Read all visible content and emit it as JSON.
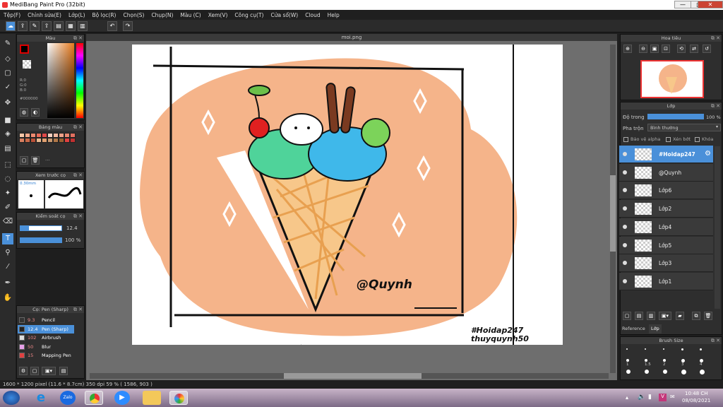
{
  "window": {
    "title": "MediBang Paint Pro (32bit)",
    "min": "—",
    "max": "□",
    "close": "✕"
  },
  "menu": [
    "Tệp(F)",
    "Chỉnh sửa(E)",
    "Lớp(L)",
    "Bộ lọc(R)",
    "Chọn(S)",
    "Chụp(N)",
    "Màu (C)",
    "Xem(V)",
    "Công cụ(T)",
    "Cửa sổ(W)",
    "Cloud",
    "Help"
  ],
  "document": {
    "tab": "moi.png"
  },
  "panels": {
    "color": {
      "title": "Màu",
      "r": "R:0",
      "g": "G:0",
      "b": "B:0",
      "hex": "#000000"
    },
    "palette": {
      "title": "Bảng màu",
      "colors": [
        "#f7c7a8",
        "#f4a98a",
        "#ef8a70",
        "#e86b58",
        "#e04848",
        "#f7d0c0",
        "#f3b8a0",
        "#eea088",
        "#e88870",
        "#e27060",
        "#d88060",
        "#c86848",
        "#b85038",
        "#e8b890",
        "#e0a070",
        "#c89870",
        "#b07848",
        "#986030",
        "#e04040",
        "#c03030"
      ],
      "more": "···"
    },
    "preview": {
      "title": "Xem trước cọ",
      "size": "0.30mm"
    },
    "control": {
      "title": "Kiểm soát cọ",
      "size_value": "12.4",
      "opacity_value": "100 %"
    },
    "brush": {
      "title": "Cọ: Pen (Sharp)",
      "items": [
        {
          "size": "9.3",
          "name": "Pencil",
          "color": "#333"
        },
        {
          "size": "12.4",
          "name": "Pen (Sharp)",
          "color": "#222"
        },
        {
          "size": "102",
          "name": "Airbrush",
          "color": "#ddd"
        },
        {
          "size": "50",
          "name": "Blur",
          "color": "#e8a0e8"
        },
        {
          "size": "15",
          "name": "Mapping Pen",
          "color": "#e04040"
        }
      ]
    },
    "navigator": {
      "title": "Hoa tiêu"
    },
    "layers": {
      "title": "Lớp",
      "opacity_label": "Độ trong",
      "opacity_value": "100 %",
      "blend_label": "Pha trộn",
      "blend_value": "Bình thường",
      "protect_alpha": "Bảo vệ alpha",
      "clipping": "Xén bớt",
      "lock": "Khóa",
      "items": [
        {
          "name": "#Hoidap247",
          "selected": true
        },
        {
          "name": "@Quynh"
        },
        {
          "name": "Lớp6"
        },
        {
          "name": "Lớp2"
        },
        {
          "name": "Lớp4"
        },
        {
          "name": "Lớp5"
        },
        {
          "name": "Lớp3"
        },
        {
          "name": "Lớp1"
        }
      ],
      "tabs": [
        "Reference",
        "Lớp"
      ]
    },
    "brushsize": {
      "title": "Brush Size",
      "labels": [
        "1",
        "1.5",
        "2",
        "3",
        "4"
      ]
    }
  },
  "artwork": {
    "signature": "@Quynh",
    "tag": "#Hoidap247",
    "author": "thuyquynh50"
  },
  "status": "1600 * 1200 pixel  (11.6 * 8.7cm)  350 dpi  59 %  ( 1586, 903 )",
  "taskbar": {
    "time": "10:48 CH",
    "date": "08/08/2021",
    "zalo": "Zalo"
  }
}
